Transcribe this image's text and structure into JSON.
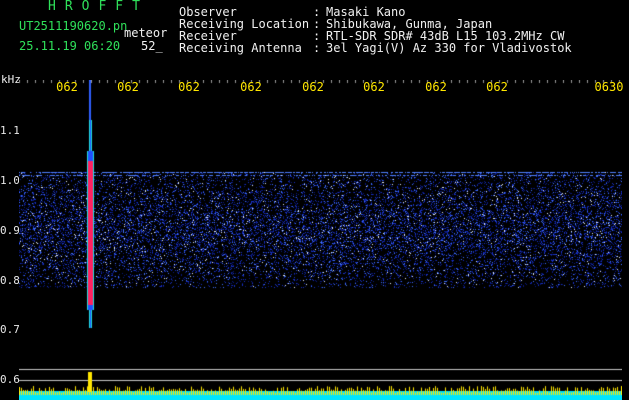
{
  "header": {
    "app_title": "HROFFT",
    "file_name": "UT2511190620.pn",
    "tag": "meteor",
    "datetime": "25.11.19 06:20",
    "count": "52_"
  },
  "info": [
    {
      "key": "Observer",
      "value": "Masaki Kano"
    },
    {
      "key": "Receiving Location",
      "value": "Shibukawa, Gunma, Japan"
    },
    {
      "key": "Receiver",
      "value": "RTL-SDR SDR# 43dB L15 103.2MHz CW"
    },
    {
      "key": "Receiving Antenna",
      "value": "3el Yagi(V) Az 330 for Vladivostok"
    }
  ],
  "colon": ":",
  "axis": {
    "y_unit": "kHz",
    "y_ticks": [
      "1.1",
      "1.0",
      "0.9",
      "0.8",
      "0.7",
      "0.6"
    ],
    "x_ticks": [
      "062",
      "062",
      "062",
      "062",
      "062",
      "062",
      "062",
      "062",
      "0630"
    ]
  },
  "colors": {
    "band": "#1830c8",
    "meteor_core": "#ff2060",
    "meteor_edge": "#20e0e0",
    "baseline": "#00e5ff",
    "bottom_peaks": "#ffe600",
    "title": "#2fe05a"
  }
}
